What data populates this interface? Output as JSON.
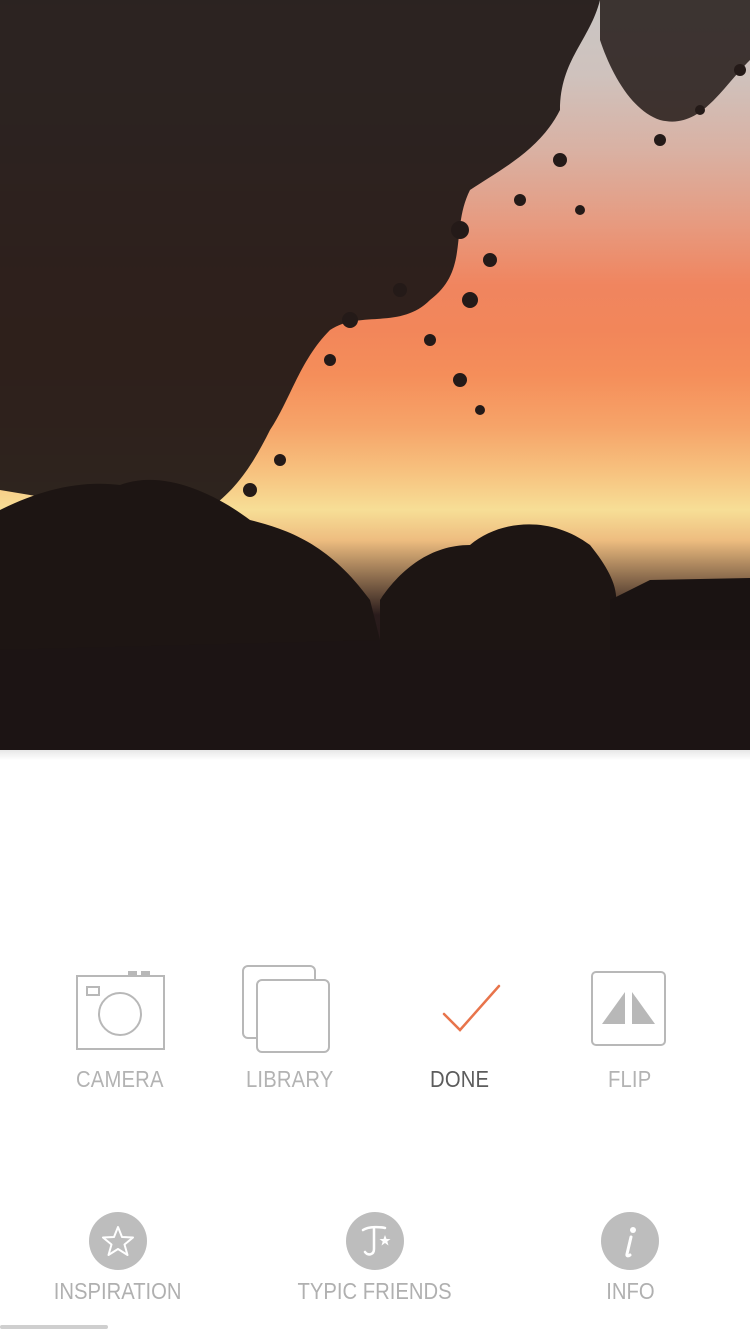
{
  "photo": {
    "description_icon": "sunset-photo",
    "colors": {
      "sky_top": "#c9c6c4",
      "sky_orange": "#f2865a",
      "sky_glow": "#f7de96",
      "silhouette": "#1f1616"
    }
  },
  "tools": [
    {
      "id": "camera",
      "label": "CAMERA",
      "icon": "camera-icon",
      "active": false
    },
    {
      "id": "library",
      "label": "LIBRARY",
      "icon": "library-icon",
      "active": false
    },
    {
      "id": "done",
      "label": "DONE",
      "icon": "checkmark-icon",
      "active": true
    },
    {
      "id": "flip",
      "label": "FLIP",
      "icon": "flip-icon",
      "active": false
    }
  ],
  "nav": [
    {
      "id": "inspiration",
      "label": "INSPIRATION",
      "icon": "star-icon"
    },
    {
      "id": "typic_friends",
      "label": "TYPIC FRIENDS",
      "icon": "typic-logo-icon"
    },
    {
      "id": "info",
      "label": "INFO",
      "icon": "info-icon"
    }
  ],
  "colors": {
    "accent": "#e8744b",
    "icon_gray": "#b8b8b8",
    "active_text": "#5c5c5c",
    "nav_circle": "#bdbdbd"
  }
}
